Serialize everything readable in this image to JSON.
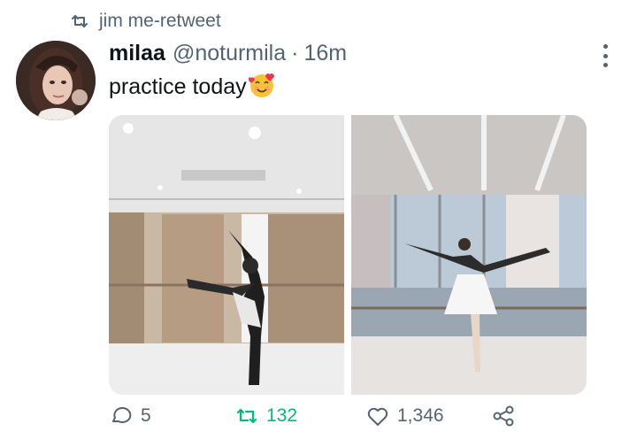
{
  "retweet_context": {
    "icon": "retweet-icon",
    "text": "jim me-retweet"
  },
  "author": {
    "display_name": "milaa",
    "handle": "@noturmila",
    "separator": "·",
    "time": "16m"
  },
  "tweet": {
    "text": "practice today",
    "emoji": "smiling-face-with-hearts"
  },
  "media": [
    {
      "alt": "ballet dancer stretching on barre in dance studio"
    },
    {
      "alt": "ballet dancer in tutu posing in arabesque by windows"
    }
  ],
  "actions": {
    "reply_count": "5",
    "retweet_count": "132",
    "like_count": "1,346",
    "retweet_active_color": "#00ba7c",
    "muted_color": "#536471"
  }
}
